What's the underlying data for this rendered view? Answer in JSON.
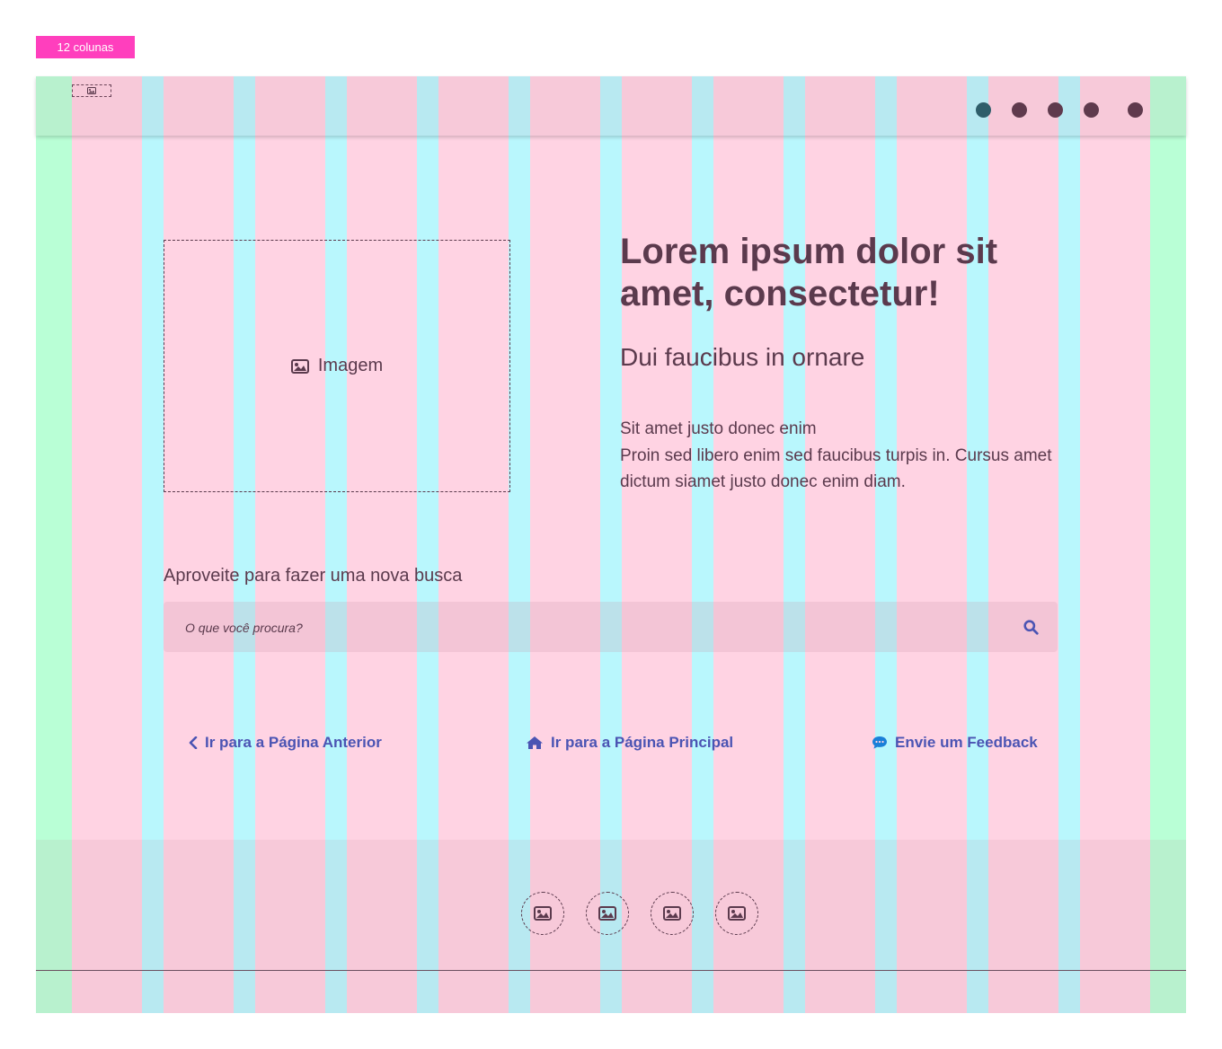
{
  "grid_tag": {
    "label": "12 colunas"
  },
  "colors": {
    "accent": "#ff3fbd",
    "margin": "#b9ffd6",
    "gutter": "#b9f7fd",
    "column": "#ffd3e3",
    "text": "#5b3a4d",
    "link": "#4b54b3"
  },
  "header": {
    "logo_icon": "image-icon",
    "dots_count": 5
  },
  "hero": {
    "image_placeholder": {
      "icon": "image-icon",
      "label": "Imagem"
    },
    "title": "Lorem ipsum dolor sit amet, consectetur!",
    "subtitle": "Dui faucibus in ornare",
    "body_line1": "Sit amet justo donec enim",
    "body_line2": "Proin sed libero enim sed faucibus turpis in. Cursus amet dictum siamet justo donec enim diam."
  },
  "search": {
    "label": "Aproveite para fazer uma nova busca",
    "placeholder": "O que você procura?",
    "icon": "search-icon"
  },
  "nav": {
    "back": {
      "icon": "chevron-left-icon",
      "label": "Ir para a Página Anterior"
    },
    "home": {
      "icon": "home-icon",
      "label": "Ir para a Página Principal"
    },
    "feedback": {
      "icon": "comment-icon",
      "label": "Envie um Feedback"
    }
  },
  "footer": {
    "icons": [
      "image-icon",
      "image-icon",
      "image-icon",
      "image-icon"
    ]
  }
}
